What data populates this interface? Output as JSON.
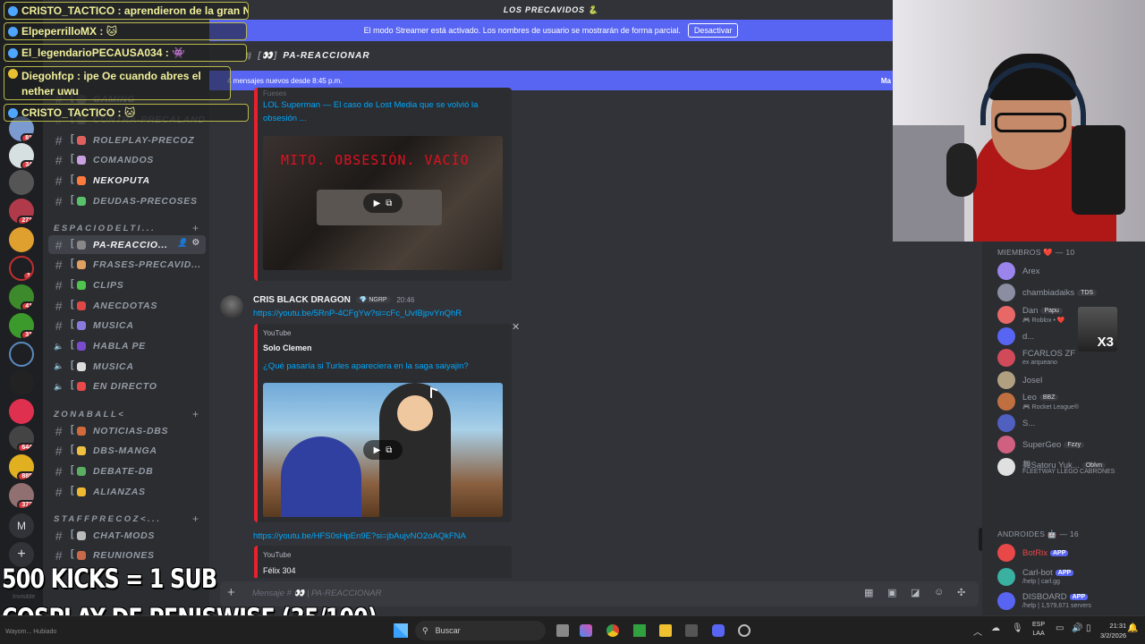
{
  "server": {
    "name": "LOS PRECAVIDOS 🐍",
    "icon": "snake-emoji"
  },
  "streamer_bar": {
    "text": "El modo Streamer está activado. Los nombres de usuario se mostrarán de forma parcial.",
    "button": "Desactivar"
  },
  "channel_header": {
    "name": "PA-REACCIONAR"
  },
  "new_messages": {
    "text": "4 mensajes nuevos desde 8:45 p.m.",
    "action": "Ma"
  },
  "channels": {
    "partial_top": [
      "GAMING",
      "CONTRA-PRECALAND"
    ],
    "group1": [
      {
        "name": "ROLEPLAY-PRECOZ",
        "emoji_color": "#e06060"
      },
      {
        "name": "COMANDOS",
        "emoji_color": "#c9a0e0"
      },
      {
        "name": "NEKOPUTA",
        "emoji_color": "#ff7a3d"
      },
      {
        "name": "DEUDAS-PRECOSES",
        "emoji_color": "#58c26a"
      }
    ],
    "cat_espacio": "ESPACIODELTI...",
    "group2": [
      {
        "name": "PA-REACCIO...",
        "emoji_color": "#888888"
      },
      {
        "name": "FRASES-PRECAVID...",
        "emoji_color": "#e0a060"
      },
      {
        "name": "CLIPS",
        "emoji_color": "#4ec34e"
      },
      {
        "name": "ANECDOTAS",
        "emoji_color": "#e04848"
      },
      {
        "name": "MUSICA",
        "emoji_color": "#8a7ae0"
      },
      {
        "name": "HABLA PE",
        "emoji_color": "#7a4ad0"
      },
      {
        "name": "MUSICA",
        "emoji_color": "#dddddd"
      },
      {
        "name": "EN DIRECTO",
        "emoji_color": "#e84848"
      }
    ],
    "cat_zona": "ZONABALL<",
    "group3": [
      {
        "name": "NOTICIAS-DBS",
        "emoji_color": "#d06a3a"
      },
      {
        "name": "DBS-MANGA",
        "emoji_color": "#f0c040"
      },
      {
        "name": "DEBATE-DB",
        "emoji_color": "#5ab060"
      },
      {
        "name": "ALIANZAS",
        "emoji_color": "#f0b830"
      }
    ],
    "cat_staff": "STAFFPRECOZ<...",
    "group4": [
      {
        "name": "CHAT-MODS",
        "emoji_color": "#bbbbbb"
      },
      {
        "name": "REUNIONES",
        "emoji_color": "#c86a4a"
      }
    ]
  },
  "rail_badges": [
    "81",
    "34",
    "271",
    "1",
    "41",
    "31",
    "644",
    "885",
    "372"
  ],
  "rail_letter": "M",
  "messages": {
    "first_embed": {
      "author_partial": "Fueses",
      "title": "LOL Superman — El caso de Lost Media que se volvió la obsesión ...",
      "thumbnail_text": "MITO. OBSESIÓN. VACÍO"
    },
    "second": {
      "user": "CRIS BLACK DRAGON",
      "badge": "NGRP",
      "time": "20:46",
      "link": "https://youtu.be/5RnP-4CFgYw?si=cFc_UvIBjpvYnQhR",
      "embed_provider": "YouTube",
      "embed_author": "Solo Clemen",
      "embed_title": "¿Qué pasaría si Turles apareciera en la saga saiyajin?"
    },
    "third": {
      "link": "https://youtu.be/HFS0sHpEn9E?si=jbAujvNO2oAQkFNA",
      "embed_provider": "YouTube",
      "embed_author": "Félix 304"
    }
  },
  "composer": {
    "placeholder": "Mensaje # 👀 | PA-REACCIONAR"
  },
  "members": {
    "header_1": "MIEMBROS ❤️ — 10",
    "list_1": [
      {
        "name": "Arex",
        "sub": "",
        "tag": "",
        "color": "#9b84ec"
      },
      {
        "name": "chambiadaiks",
        "sub": "",
        "tag": "TDS",
        "color": "#8a8ea0"
      },
      {
        "name": "Dan",
        "sub": "🎮 Roblox • ❤️",
        "tag": "Papu",
        "color": "#e86868"
      },
      {
        "name": "d...",
        "sub": "",
        "tag": "",
        "color": "#5865f2"
      },
      {
        "name": "FCARLOS ZF",
        "sub": "ex arqueano",
        "tag": "",
        "color": "#d04a5a"
      },
      {
        "name": "Josel",
        "sub": "",
        "tag": "",
        "color": "#b0a080"
      },
      {
        "name": "Leo",
        "sub": "🎮 Rocket League®",
        "tag": "BBZ",
        "color": "#c07040"
      },
      {
        "name": "S...",
        "sub": "",
        "tag": "",
        "color": "#5060c0"
      },
      {
        "name": "SuperGeo",
        "sub": "",
        "tag": "Fzzy",
        "color": "#d06080"
      },
      {
        "name": "舞Satoru Yuk...",
        "sub": "FLEETWAY LLEGO CABRONES",
        "tag": "Oblvn",
        "color": "#e0e0e0"
      }
    ],
    "header_2": "ANDROIDES 🤖 — 16",
    "list_2": [
      {
        "name": "BotRix",
        "sub": "",
        "tag": "APP",
        "color": "#e84848"
      },
      {
        "name": "Carl-bot",
        "sub": "/help | carl.gg",
        "tag": "APP",
        "color": "#3ab0a0"
      },
      {
        "name": "DISBOARD",
        "sub": "/help | 1,579,671 servers",
        "tag": "APP",
        "color": "#5865f2"
      }
    ]
  },
  "overlay_chat": [
    {
      "text": "CRISTO_TACTICO : aprendieron de la gran N"
    },
    {
      "text": "ElpeperrilloMX : 🐱"
    },
    {
      "text": "El_legendarioPECAUSA034 : 👾"
    },
    {
      "text": "Diegohfcp : ipe Oe cuando abres el nether uwu"
    },
    {
      "text": "CRISTO_TACTICO : 🐱"
    }
  ],
  "stream_text": {
    "line1": "500 KICKS = 1 SUB",
    "line2": "COSPLAY DE PENISWISE (35/100)"
  },
  "user_panel": {
    "status": "Invisible",
    "name_partial": "Wayom... Hubiado"
  },
  "webcam_overlay": "X3",
  "taskbar": {
    "search": "Buscar",
    "lang_top": "ESP",
    "lang_bottom": "LAA",
    "time": "21:31",
    "date": "3/2/2026"
  }
}
